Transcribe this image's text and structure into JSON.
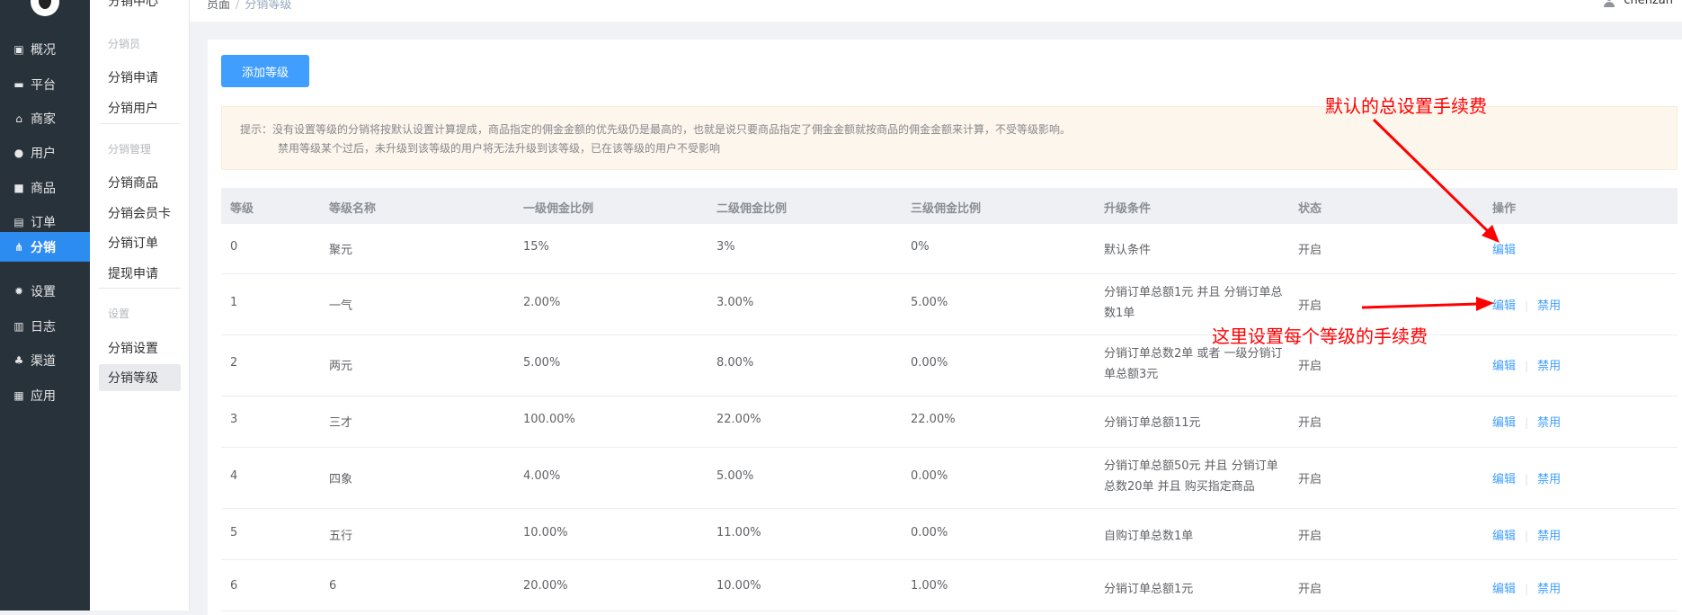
{
  "sidebar": {
    "items": [
      {
        "label": "概况",
        "icon": "dashboard-icon"
      },
      {
        "label": "平台",
        "icon": "monitor-icon"
      },
      {
        "label": "商家",
        "icon": "store-icon"
      },
      {
        "label": "用户",
        "icon": "user-icon"
      },
      {
        "label": "商品",
        "icon": "goods-icon"
      },
      {
        "label": "订单",
        "icon": "order-icon"
      },
      {
        "label": "分销",
        "icon": "distribution-icon",
        "active": true
      },
      {
        "label": "设置",
        "icon": "gear-icon"
      },
      {
        "label": "日志",
        "icon": "log-icon"
      },
      {
        "label": "渠道",
        "icon": "channel-icon"
      },
      {
        "label": "应用",
        "icon": "apps-icon"
      }
    ]
  },
  "submenu": {
    "title": "分销中心",
    "group1": "分销员",
    "item_apply": "分销申请",
    "item_users": "分销用户",
    "group2": "分销管理",
    "item_goods": "分销商品",
    "item_card": "分销会员卡",
    "item_orders": "分销订单",
    "item_withdraw": "提现申请",
    "group3": "设置",
    "item_settings": "分销设置",
    "item_levels": "分销等级"
  },
  "header": {
    "breadcrumb_home": "员面",
    "breadcrumb_sep": "/",
    "breadcrumb_current": "分销等级",
    "username": "chenzan"
  },
  "main": {
    "add_button": "添加等级",
    "tip_line1": "提示：没有设置等级的分销将按默认设置计算提成，商品指定的佣金金额的优先级仍是最高的，也就是说只要商品指定了佣金金额就按商品的佣金金额来计算，不受等级影响。",
    "tip_line2": "禁用等级某个过后，未升级到该等级的用户将无法升级到该等级，已在该等级的用户不受影响"
  },
  "table": {
    "headers": [
      "等级",
      "等级名称",
      "一级佣金比例",
      "二级佣金比例",
      "三级佣金比例",
      "升级条件",
      "状态",
      "操作"
    ],
    "rows": [
      {
        "level": "0",
        "name": "聚元",
        "r1": "15%",
        "r2": "3%",
        "r3": "0%",
        "condition": "默认条件",
        "status": "开启",
        "edit": "编辑",
        "disable": ""
      },
      {
        "level": "1",
        "name": "一气",
        "r1": "2.00%",
        "r2": "3.00%",
        "r3": "5.00%",
        "condition": "分销订单总额1元 并且 分销订单总数1单",
        "status": "开启",
        "edit": "编辑",
        "disable": "禁用"
      },
      {
        "level": "2",
        "name": "两元",
        "r1": "5.00%",
        "r2": "8.00%",
        "r3": "0.00%",
        "condition": "分销订单总数2单 或者 一级分销订单总额3元",
        "status": "开启",
        "edit": "编辑",
        "disable": "禁用"
      },
      {
        "level": "3",
        "name": "三才",
        "r1": "100.00%",
        "r2": "22.00%",
        "r3": "22.00%",
        "condition": "分销订单总额11元",
        "status": "开启",
        "edit": "编辑",
        "disable": "禁用"
      },
      {
        "level": "4",
        "name": "四象",
        "r1": "4.00%",
        "r2": "5.00%",
        "r3": "0.00%",
        "condition": "分销订单总额50元 并且 分销订单总数20单 并且 购买指定商品",
        "status": "开启",
        "edit": "编辑",
        "disable": "禁用"
      },
      {
        "level": "5",
        "name": "五行",
        "r1": "10.00%",
        "r2": "11.00%",
        "r3": "0.00%",
        "condition": "自购订单总数1单",
        "status": "开启",
        "edit": "编辑",
        "disable": "禁用"
      },
      {
        "level": "6",
        "name": "6",
        "r1": "20.00%",
        "r2": "10.00%",
        "r3": "1.00%",
        "condition": "分销订单总额1元",
        "status": "开启",
        "edit": "编辑",
        "disable": "禁用"
      }
    ]
  },
  "annotations": {
    "default_fee": "默认的总设置手续费",
    "per_level_fee": "这里设置每个等级的手续费",
    "color": "#ff0000"
  }
}
